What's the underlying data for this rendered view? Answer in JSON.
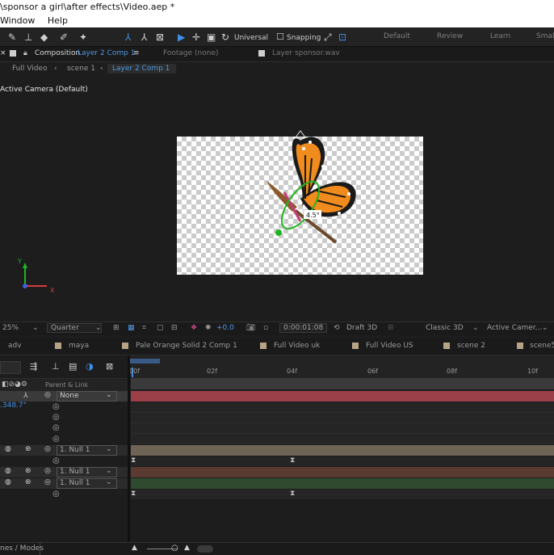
{
  "window": {
    "title": "\\sponsor a girl\\after effects\\Video.aep *"
  },
  "menu": [
    "Window",
    "Help"
  ],
  "toolbar": {
    "axis_mode": "Universal",
    "snapping": "Snapping",
    "workspaces": [
      "Default",
      "Review",
      "Learn",
      "Small"
    ]
  },
  "panel_tabs": {
    "close": "×",
    "composition_prefix": "Composition",
    "composition_name": "Layer 2 Comp 1",
    "menu": "≡",
    "footage": "Footage (none)",
    "layer": "Layer sponsor.wav"
  },
  "breadcrumbs": [
    "Full Video",
    "scene 1",
    "Layer 2 Comp 1"
  ],
  "viewer": {
    "camera_label": "Active Camera (Default)",
    "rotation_readout": "4.5°",
    "axis_y": "Y",
    "axis_x": "X"
  },
  "viewer_bar": {
    "zoom": "25%",
    "resolution": "Quarter",
    "exposure": "+0.0",
    "timecode": "0:00:01:08",
    "draft": "Draft 3D",
    "renderer": "Classic 3D",
    "view": "Active Camer..."
  },
  "timeline_tabs": [
    "adv",
    "maya",
    "Pale Orange Solid 2 Comp 1",
    "Full Video uk",
    "Full Video US",
    "scene 2",
    "scene5"
  ],
  "timeline": {
    "parent_header": "Parent & Link",
    "ruler": [
      "00f",
      "02f",
      "04f",
      "06f",
      "08f",
      "10f"
    ],
    "value_readout": ".348.7°",
    "layers": [
      {
        "parent": "None"
      },
      {
        "parent": "1. Null 1"
      },
      {
        "parent": "1. Null 1"
      },
      {
        "parent": "1. Null 1"
      }
    ]
  },
  "bottom_bar": {
    "toggle": "nes / Modes"
  },
  "colors": {
    "accent": "#3f8fe8",
    "track_red": "#9b3f48",
    "track_tan": "#6e6456",
    "track_brown": "#5b3b30",
    "track_green": "#2f4a2f",
    "motion_green": "#21b421"
  }
}
